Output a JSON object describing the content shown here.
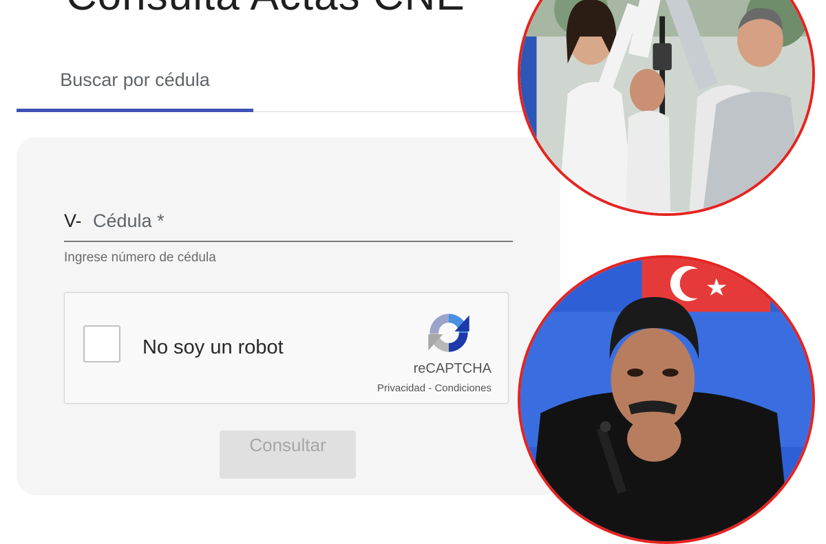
{
  "header": {
    "title": "Consulta Actas CNE"
  },
  "tabs": [
    {
      "label": "Buscar por cédula",
      "active": true
    }
  ],
  "form": {
    "prefix": "V-",
    "cedula_label": "Cédula *",
    "cedula_value": "",
    "hint": "Ingrese número de cédula",
    "submit_label": "Consultar",
    "submit_enabled": false
  },
  "captcha": {
    "label": "No soy un robot",
    "checked": false,
    "brand": "reCAPTCHA",
    "privacy": "Privacidad",
    "separator": " - ",
    "terms": "Condiciones"
  },
  "photos": [
    {
      "subject": "two people raising joined hands at a rally",
      "frame_color": "#e52420"
    },
    {
      "subject": "man in dark jacket, hand on chin, flag behind",
      "frame_color": "#e52420"
    }
  ],
  "colors": {
    "accent": "#3f51b5",
    "card_bg": "#f5f5f5",
    "frame": "#e52420"
  }
}
